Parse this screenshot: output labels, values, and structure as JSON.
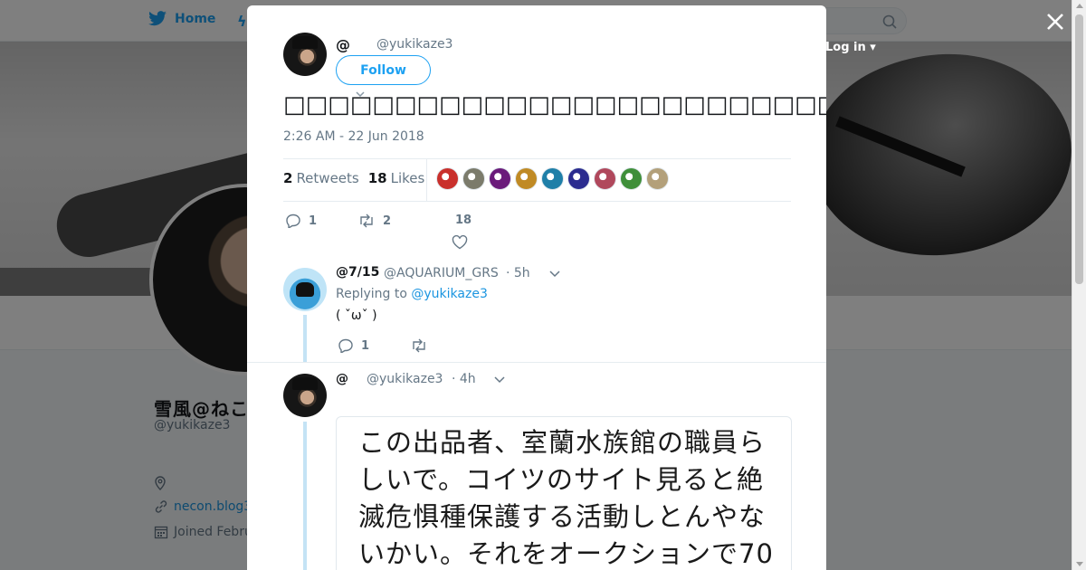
{
  "nav": {
    "home_label": "Home",
    "login_label": "Log in"
  },
  "profile": {
    "name": "雪風@ねこん",
    "handle": "@yukikaze3",
    "website": "necon.blog3",
    "joined": "Joined Febru"
  },
  "tweet": {
    "author_name": "@",
    "author_handle": "@yukikaze3",
    "follow_label": "Follow",
    "text": "□□□□□□□□□□□□□□□□□□□□□□□□□□□□□□□□□□□□□□□□□□□…□□□□□□□□□□",
    "timestamp": "2:26 AM - 22 Jun 2018",
    "retweets_count": "2",
    "retweets_label": "Retweets",
    "likes_count": "18",
    "likes_label": "Likes",
    "action_reply_count": "1",
    "action_retweet_count": "2",
    "action_like_count": "18"
  },
  "likers": [
    {
      "color": "#c9302c"
    },
    {
      "color": "#7b7b6b"
    },
    {
      "color": "#6a1b7a"
    },
    {
      "color": "#c08a24"
    },
    {
      "color": "#1f7fa8"
    },
    {
      "color": "#2b2c8f"
    },
    {
      "color": "#b0485c"
    },
    {
      "color": "#3f8f3a"
    },
    {
      "color": "#b3a07a"
    }
  ],
  "replies": [
    {
      "name": "@7/15",
      "handle": "@AQUARIUM_GRS",
      "time": "· 5h",
      "replying_prefix": "Replying to",
      "replying_to": "@yukikaze3",
      "text": "( ˇωˇ )",
      "reply_count": "1"
    },
    {
      "name": "@",
      "handle": "@yukikaze3",
      "time": "· 4h",
      "image_text": "この出品者、室蘭水族館の職員らしいで。コイツのサイト見ると絶滅危惧種保護する活動しとんやないかい。それをオークションで70"
    }
  ],
  "colors": {
    "accent": "#1da1f2",
    "link": "#1b95e0",
    "muted": "#657786"
  }
}
